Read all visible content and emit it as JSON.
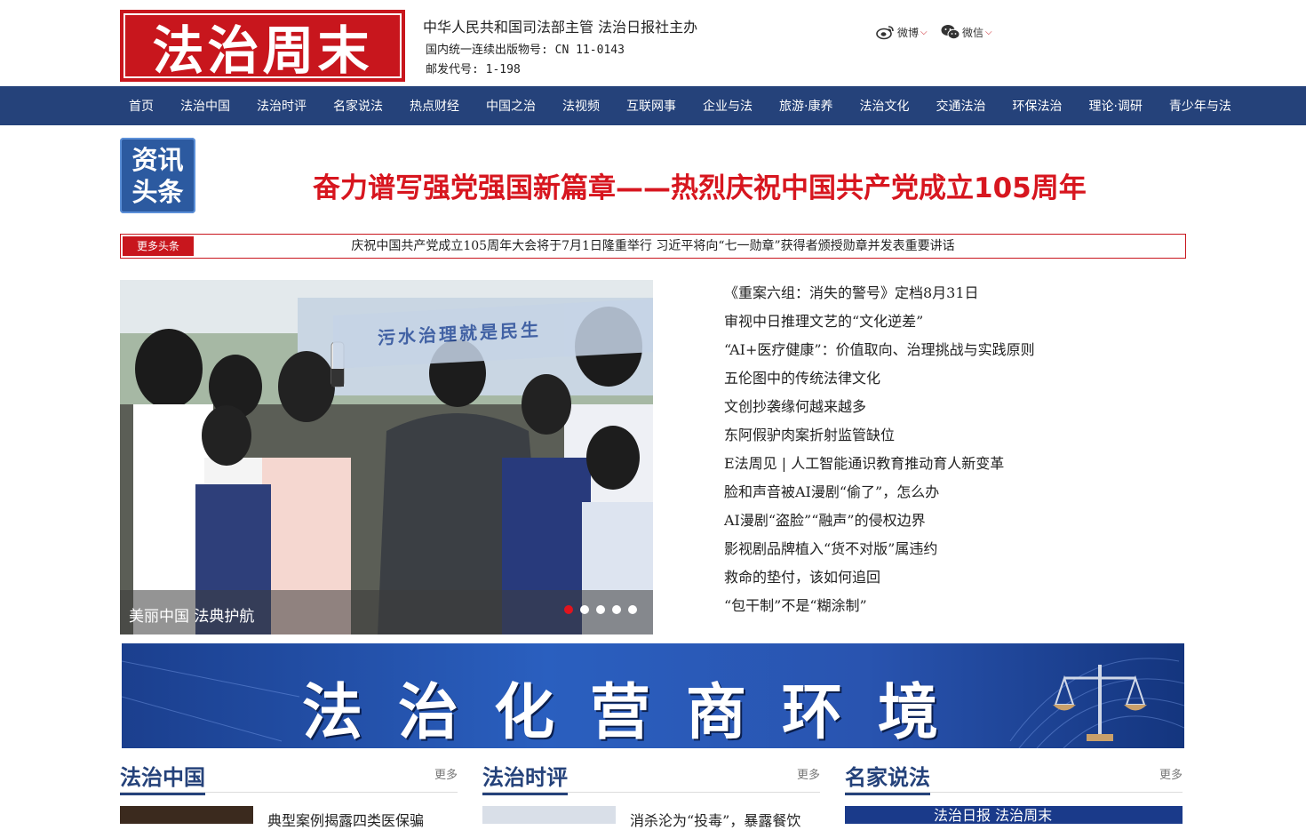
{
  "header": {
    "logo_text": "法治周末",
    "sponsor": "中华人民共和国司法部主管 法治日报社主办",
    "issn": "国内统一连续出版物号: CN 11-0143",
    "postal": "邮发代号: 1-198",
    "weibo_label": "微博",
    "wechat_label": "微信"
  },
  "nav": {
    "items": [
      "首页",
      "法治中国",
      "法治时评",
      "名家说法",
      "热点财经",
      "中国之治",
      "法视频",
      "互联网事",
      "企业与法",
      "旅游·康养",
      "法治文化",
      "交通法治",
      "环保法治",
      "理论·调研",
      "青少年与法"
    ]
  },
  "headline": {
    "badge_line1": "资讯",
    "badge_line2": "头条",
    "banner": "奋力谱写强党强国新篇章——热烈庆祝中国共产党成立105周年",
    "ticker_more": "更多头条",
    "ticker_text": "庆祝中国共产党成立105周年大会将于7月1日隆重举行 习近平将向“七一勋章”获得者颁授勋章并发表重要讲话"
  },
  "carousel": {
    "sign_text": "污水治理就是民生",
    "caption": "美丽中国 法典护航",
    "dots": 5,
    "active_dot": 0
  },
  "headlines": [
    "《重案六组：消失的警号》定档8月31日",
    "审视中日推理文艺的“文化逆差”",
    "“AI+医疗健康”：价值取向、治理挑战与实践原则",
    "五伦图中的传统法律文化",
    "文创抄袭缘何越来越多",
    "东阿假驴肉案折射监管缺位",
    "E法周见 | 人工智能通识教育推动育人新变革",
    "脸和声音被AI漫剧“偷了”，怎么办",
    "AI漫剧“盗脸”“融声”的侵权边界",
    "影视剧品牌植入“货不对版”属违约",
    "救命的垫付，该如何追回",
    "“包干制”不是“糊涂制”"
  ],
  "business_banner": "法治化营商环境",
  "sections": [
    {
      "title": "法治中国",
      "more": "更多",
      "first_item": "典型案例揭露四类医保骗"
    },
    {
      "title": "法治时评",
      "more": "更多",
      "first_item": "消杀沦为“投毒”，暴露餐饮"
    },
    {
      "title": "名家说法",
      "more": "更多",
      "thumb_text": "法治日报 法治周末"
    }
  ],
  "colors": {
    "brand_red": "#c8161d",
    "nav_blue": "#25427a",
    "headline_red": "#d7161f"
  }
}
